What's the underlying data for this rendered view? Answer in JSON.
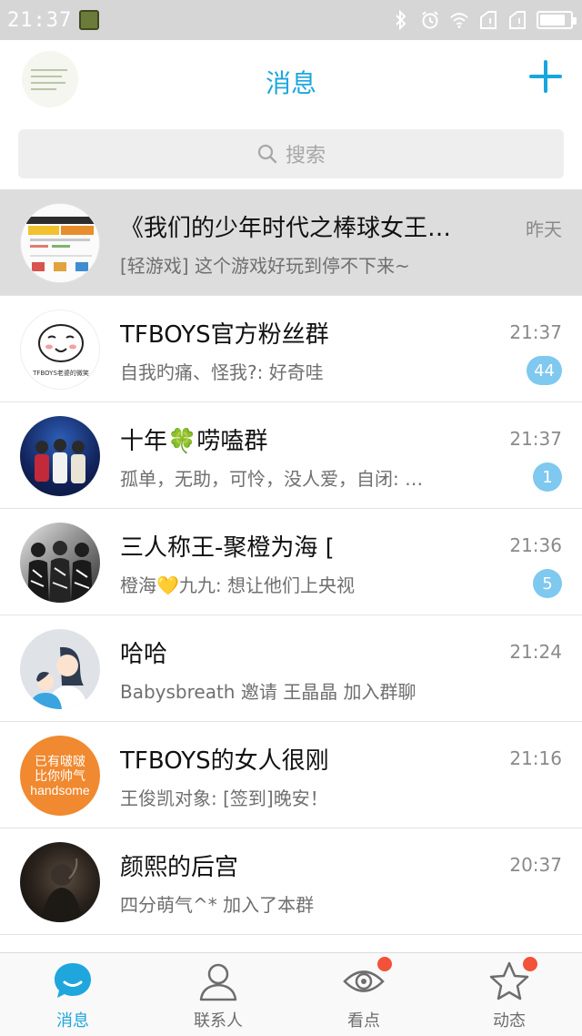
{
  "status_bar": {
    "time": "21:37",
    "icons": [
      "app-icon",
      "bluetooth-icon",
      "alarm-icon",
      "wifi-icon",
      "signal-icon",
      "signal-icon",
      "battery-icon"
    ],
    "battery_level": 0.85
  },
  "header": {
    "title": "消息",
    "add_icon": "plus-icon"
  },
  "search": {
    "placeholder": "搜索"
  },
  "chats": [
    {
      "name": "《我们的少年时代之棒球女王…",
      "preview": "[轻游戏] 这个游戏好玩到停不下来~",
      "time": "昨天",
      "unread": "",
      "pinned": true,
      "avatar": "game-screenshot"
    },
    {
      "name": "TFBOYS官方粉丝群",
      "preview": "自我旳痛、怪我?: 好奇哇",
      "time": "21:37",
      "unread": "44",
      "pinned": false,
      "avatar": "smiling-face",
      "avatar_caption": "TFBOYS老婆的微笑"
    },
    {
      "name": "十年🍀唠嗑群",
      "preview": "孤单，无助，可怜，没人爱，自闭: …",
      "time": "21:37",
      "unread": "1",
      "pinned": false,
      "avatar": "stage-photo"
    },
    {
      "name": "三人称王-聚橙为海 [",
      "preview": "橙海💛九九: 想让他们上央视",
      "time": "21:36",
      "unread": "5",
      "pinned": false,
      "avatar": "group-photo"
    },
    {
      "name": "哈哈",
      "preview": "Babysbreath 邀请 王晶晶 加入群聊",
      "time": "21:24",
      "unread": "",
      "pinned": false,
      "avatar": "default-group"
    },
    {
      "name": "TFBOYS的女人很刚",
      "preview": "王俊凯对象: [签到]晚安！",
      "time": "21:16",
      "unread": "",
      "pinned": false,
      "avatar": "orange-text",
      "avatar_lines": [
        "已有啵啵",
        "比你帅气",
        "handsome"
      ]
    },
    {
      "name": "颜熙的后宫",
      "preview": "四分萌气^* 加入了本群",
      "time": "20:37",
      "unread": "",
      "pinned": false,
      "avatar": "dark-photo"
    }
  ],
  "bottom_nav": [
    {
      "label": "消息",
      "icon": "chat-bubble-icon",
      "active": true,
      "dot": false
    },
    {
      "label": "联系人",
      "icon": "person-icon",
      "active": false,
      "dot": false
    },
    {
      "label": "看点",
      "icon": "eye-icon",
      "active": false,
      "dot": true
    },
    {
      "label": "动态",
      "icon": "star-icon",
      "active": false,
      "dot": true
    }
  ],
  "colors": {
    "accent": "#1fa6dd",
    "badge": "#7fc8ef",
    "pinned_bg": "#dddddd",
    "dot": "#f2523a"
  }
}
